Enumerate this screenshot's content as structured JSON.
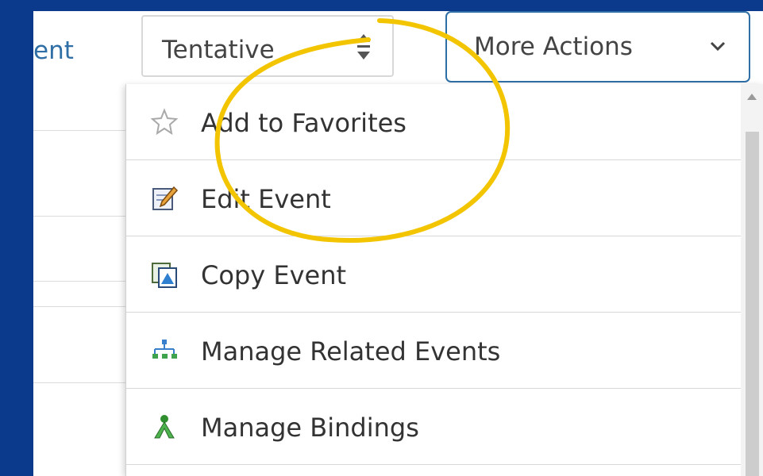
{
  "header": {
    "cropped_label": "ent",
    "state_select": {
      "value": "Tentative"
    },
    "more_actions": {
      "label": "More Actions"
    }
  },
  "menu": {
    "items": [
      {
        "label": "Add to Favorites",
        "icon": "star-outline-icon"
      },
      {
        "label": "Edit Event",
        "icon": "edit-pencil-icon"
      },
      {
        "label": "Copy Event",
        "icon": "copy-icon"
      },
      {
        "label": "Manage Related Events",
        "icon": "hierarchy-icon"
      },
      {
        "label": "Manage Bindings",
        "icon": "bindings-icon"
      }
    ]
  },
  "colors": {
    "frame": "#0b3a8c",
    "accent": "#2f6fa6",
    "highlight": "#f2c500"
  }
}
